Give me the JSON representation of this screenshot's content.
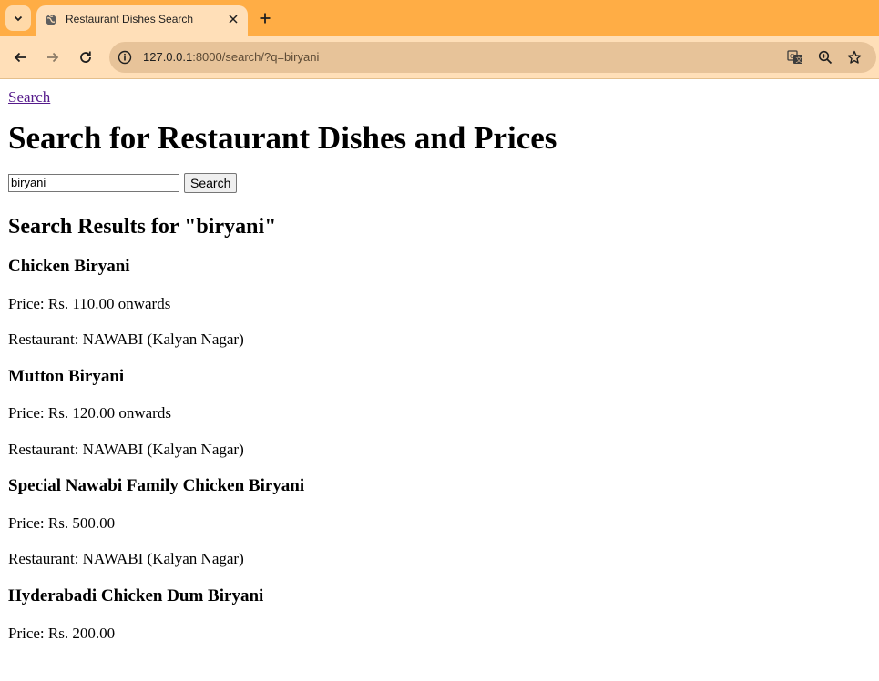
{
  "browser": {
    "tab_title": "Restaurant Dishes Search",
    "url_host": "127.0.0.1",
    "url_path": ":8000/search/?q=biryani"
  },
  "page": {
    "nav_link": "Search",
    "heading": "Search for Restaurant Dishes and Prices",
    "search_value": "biryani",
    "search_button": "Search",
    "results_heading": "Search Results for \"biryani\"",
    "results": [
      {
        "name": "Chicken Biryani",
        "price": "Price: Rs. 110.00 onwards",
        "restaurant": "Restaurant: NAWABI (Kalyan Nagar)"
      },
      {
        "name": "Mutton Biryani",
        "price": "Price: Rs. 120.00 onwards",
        "restaurant": "Restaurant: NAWABI (Kalyan Nagar)"
      },
      {
        "name": "Special Nawabi Family Chicken Biryani",
        "price": "Price: Rs. 500.00",
        "restaurant": "Restaurant: NAWABI (Kalyan Nagar)"
      },
      {
        "name": "Hyderabadi Chicken Dum Biryani",
        "price": "Price: Rs. 200.00"
      }
    ]
  },
  "icons": [
    "tab-search-icon",
    "globe-icon",
    "close-icon",
    "plus-icon",
    "back-arrow-icon",
    "forward-arrow-icon",
    "reload-icon",
    "site-info-icon",
    "translate-icon",
    "zoom-icon",
    "star-icon"
  ],
  "colors": {
    "tabbar": "#ffad45",
    "toolbar": "#ffdfb8",
    "omnibox": "#e7c399",
    "visited_link": "#551a8b"
  }
}
